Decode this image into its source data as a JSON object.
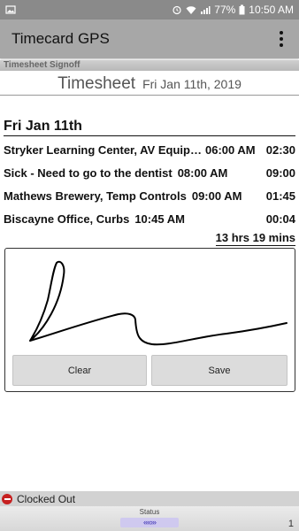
{
  "status_bar": {
    "battery": "77%",
    "time": "10:50 AM",
    "icons": [
      "picture-icon",
      "alarm-icon",
      "wifi-icon",
      "signal-icon",
      "battery-icon"
    ]
  },
  "app_bar": {
    "title": "Timecard GPS",
    "menu_icon": "overflow-menu-icon"
  },
  "section": {
    "label": "Timesheet Signoff"
  },
  "sheet": {
    "title": "Timesheet",
    "date": "Fri Jan 11th, 2019"
  },
  "day": {
    "heading": "Fri Jan 11th",
    "entries": [
      {
        "desc": "Stryker Learning Center, AV Equip…",
        "start": "06:00 AM",
        "duration": "02:30"
      },
      {
        "desc": "Sick - Need to go to the dentist",
        "start": "08:00 AM",
        "duration": "09:00"
      },
      {
        "desc": "Mathews Brewery, Temp Controls",
        "start": "09:00 AM",
        "duration": "01:45"
      },
      {
        "desc": "Biscayne Office, Curbs",
        "start": "10:45 AM",
        "duration": "00:04"
      }
    ],
    "total": "13 hrs 19 mins"
  },
  "signature": {
    "clear_label": "Clear",
    "save_label": "Save"
  },
  "clock_status": {
    "label": "Clocked Out",
    "color": "#c62020"
  },
  "bottom": {
    "status_label": "Status",
    "arrows": "‹‹‹‹›››",
    "page_number": "1"
  }
}
